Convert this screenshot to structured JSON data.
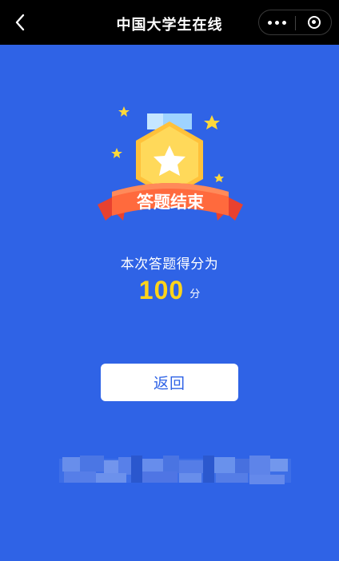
{
  "header": {
    "title": "中国大学生在线",
    "back_icon": "chevron-left-icon",
    "more_icon": "more-dots-icon",
    "close_icon": "target-close-icon"
  },
  "result": {
    "banner_text": "答题结束",
    "subtitle": "本次答题得分为",
    "score": "100",
    "score_unit": "分"
  },
  "actions": {
    "return_label": "返回"
  },
  "colors": {
    "background": "#2f63e6",
    "topbar": "#000000",
    "score": "#ffd41a",
    "button_text": "#2f63e6"
  }
}
